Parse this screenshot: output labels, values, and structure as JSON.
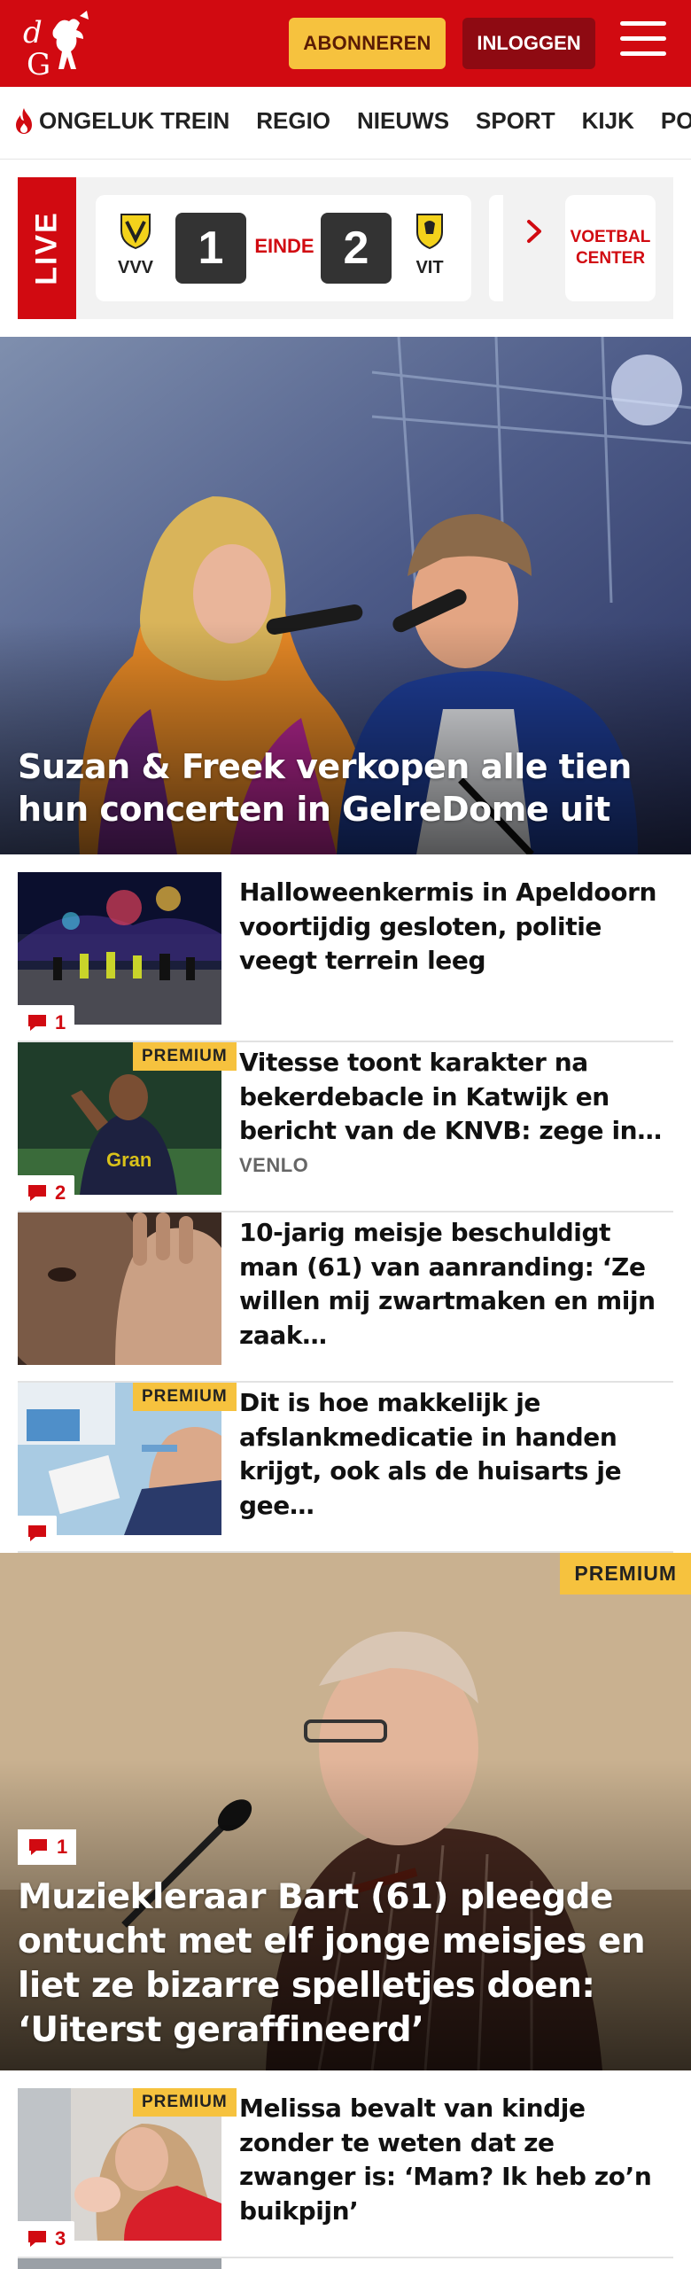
{
  "header": {
    "logo_alt": "dG",
    "subscribe_label": "ABONNEREN",
    "login_label": "INLOGGEN",
    "menu_icon": "hamburger-icon",
    "brand_color": "#d10a11"
  },
  "nav": {
    "items": [
      {
        "label": "ONGELUK TREIN",
        "icon": "flame-icon"
      },
      {
        "label": "REGIO"
      },
      {
        "label": "NIEUWS"
      },
      {
        "label": "SPORT"
      },
      {
        "label": "KIJK"
      },
      {
        "label": "PODCAST"
      }
    ]
  },
  "live": {
    "tag": "LIVE",
    "match": {
      "home": "VVV",
      "away": "VIT",
      "home_score": "1",
      "away_score": "2",
      "status": "EINDE"
    },
    "center_label": "VOETBAL CENTER"
  },
  "hero": {
    "title": "Suzan & Freek verkopen alle tien hun concerten in GelreDome uit"
  },
  "articles": [
    {
      "title": "Halloweenkermis in Apeldoorn voortijdig gesloten, politie veegt terrein leeg",
      "comments": "1",
      "premium": false,
      "tag": ""
    },
    {
      "title": "Vitesse toont karakter na bekerdebacle in Katwijk en bericht van de KNVB: zege in…",
      "comments": "2",
      "premium": true,
      "premium_label": "PREMIUM",
      "tag": "VENLO"
    },
    {
      "title": "10-jarig meisje beschuldigt man (61) van aanranding: ‘Ze willen mij zwartmaken en mijn zaak…",
      "comments": "",
      "premium": false,
      "tag": ""
    },
    {
      "title": "Dit is hoe makkelijk je afslankmedicatie in handen krijgt, ook als de huisarts je gee…",
      "comments": "",
      "premium": true,
      "premium_label": "PREMIUM",
      "tag": ""
    }
  ],
  "feature": {
    "premium_label": "PREMIUM",
    "comments": "1",
    "title": "Muziekleraar Bart (61) pleegde ontucht met elf jonge meisjes en liet ze bizarre spelletjes doen: ‘Uiterst geraffineerd’"
  },
  "article_last": {
    "title": "Melissa bevalt van kindje zonder te weten dat ze zwanger is: ‘Mam? Ik heb zo’n buikpijn’",
    "comments": "3",
    "premium_label": "PREMIUM"
  }
}
